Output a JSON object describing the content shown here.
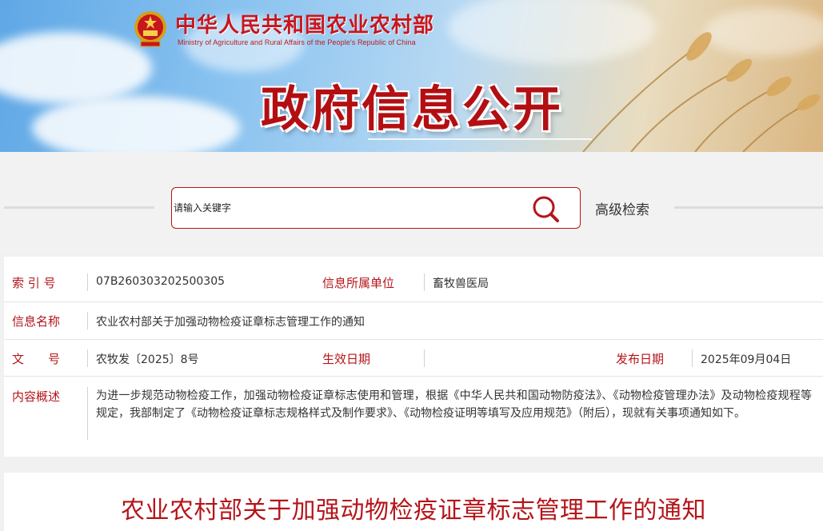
{
  "header": {
    "site_title": "中华人民共和国农业农村部",
    "site_subtitle": "Ministry of Agriculture and Rural Affairs of the People's Republic of China",
    "banner_title": "政府信息公开",
    "emblem_icon": "national-emblem-icon"
  },
  "search": {
    "placeholder": "请输入关键字",
    "advanced_label": "高级检索",
    "icon": "search-icon"
  },
  "info": {
    "index_label": "索 引 号",
    "index_value": "07B260303202500305",
    "unit_label": "信息所属单位",
    "unit_value": "畜牧兽医局",
    "name_label": "信息名称",
    "name_value": "农业农村部关于加强动物检疫证章标志管理工作的通知",
    "doc_label": "文　　号",
    "doc_value": "农牧发〔2025〕8号",
    "effective_label": "生效日期",
    "effective_value": "",
    "publish_label": "发布日期",
    "publish_value": "2025年09月04日",
    "summary_label": "内容概述",
    "summary_value": "为进一步规范动物检疫工作，加强动物检疫证章标志使用和管理，根据《中华人民共和国动物防疫法》、《动物检疫管理办法》及动物检疫规程等规定，我部制定了《动物检疫证章标志规格样式及制作要求》、《动物检疫证明等填写及应用规范》（附后），现就有关事项通知如下。"
  },
  "article": {
    "title": "农业农村部关于加强动物检疫证章标志管理工作的通知"
  },
  "colors": {
    "accent_red": "#b4151a",
    "text": "#333333"
  }
}
